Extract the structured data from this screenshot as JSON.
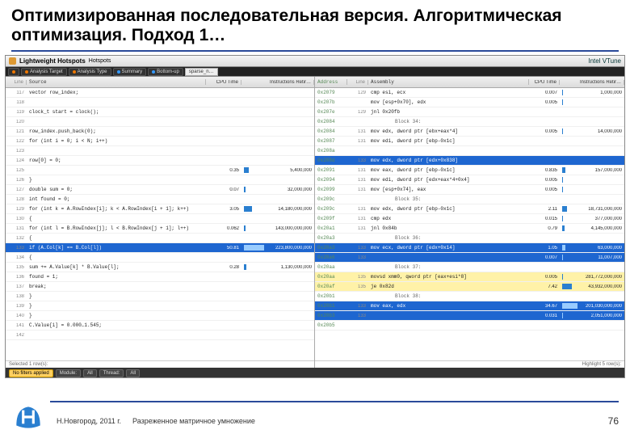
{
  "slide": {
    "title": "Оптимизированная последовательная версия. Алгоритмическая оптимизация. Подход 1…",
    "footer_left": "Н.Новгород, 2011 г.",
    "footer_center": "Разреженное матричное умножение",
    "page": "76"
  },
  "profiler": {
    "window_title": "Lightweight Hotspots",
    "window_sub": "Hotspots",
    "brand": "Intel VTune",
    "tabs": [
      "Analysis Target",
      "Analysis Type",
      "Summary",
      "Bottom-up"
    ],
    "file_tab": "sparse_n…",
    "left": {
      "cols": [
        "Line",
        "Source",
        "CPU Time",
        "",
        "Instructions Retir…"
      ],
      "rows": [
        {
          "line": "117",
          "src": "vector<int> row_index;",
          "cpu": "",
          "ins": ""
        },
        {
          "line": "118",
          "src": "",
          "cpu": "",
          "ins": ""
        },
        {
          "line": "119",
          "src": "clock_t start = clock();",
          "cpu": "",
          "ins": ""
        },
        {
          "line": "120",
          "src": "",
          "cpu": "",
          "ins": ""
        },
        {
          "line": "121",
          "src": "row_index.push_back(0);",
          "cpu": "",
          "ins": ""
        },
        {
          "line": "122",
          "src": "for (int i = 0; i < N; i++)",
          "cpu": "",
          "ins": ""
        },
        {
          "line": "123",
          "src": "",
          "cpu": "",
          "ins": ""
        },
        {
          "line": "124",
          "src": "  row[0] = 0;",
          "cpu": "",
          "ins": ""
        },
        {
          "line": "125",
          "src": "",
          "cpu": "0.35",
          "bar": 6,
          "ins": "5,400,000"
        },
        {
          "line": "126",
          "src": "  }",
          "cpu": "",
          "ins": ""
        },
        {
          "line": "127",
          "src": "  double sum = 0;",
          "cpu": "0.07",
          "bar": 2,
          "ins": "32,000,000"
        },
        {
          "line": "128",
          "src": "  int found = 0;",
          "cpu": "",
          "ins": ""
        },
        {
          "line": "129",
          "src": "  for (int k = A.RowIndex[i]; k < A.RowIndex[i + 1]; k++)",
          "cpu": "3.05",
          "bar": 10,
          "ins": "14,180,000,000"
        },
        {
          "line": "130",
          "src": "  {",
          "cpu": "",
          "ins": ""
        },
        {
          "line": "131",
          "src": "    for (int l = B.RowIndex[j]; l < B.RowIndex[j + 1]; l++)",
          "cpu": "0.062",
          "bar": 2,
          "ins": "143,000,000,000"
        },
        {
          "line": "132",
          "src": "    {",
          "cpu": "",
          "ins": ""
        },
        {
          "sel": true,
          "line": "133",
          "src": "     if (A.Col[k] == B.Col[l])",
          "cpu": "50.81",
          "bar": 28,
          "ins": "223,800,000,000"
        },
        {
          "line": "134",
          "src": "     {",
          "cpu": "",
          "ins": ""
        },
        {
          "line": "135",
          "src": "       sum += A.Value[k] * B.Value[l];",
          "cpu": "0.28",
          "bar": 3,
          "ins": "1,130,000,000"
        },
        {
          "line": "136",
          "src": "       found = 1;",
          "cpu": "",
          "ins": ""
        },
        {
          "line": "137",
          "src": "       break;",
          "cpu": "",
          "ins": ""
        },
        {
          "line": "138",
          "src": "     }",
          "cpu": "",
          "ins": ""
        },
        {
          "line": "139",
          "src": "    }",
          "cpu": "",
          "ins": ""
        },
        {
          "line": "140",
          "src": "  }",
          "cpu": "",
          "ins": ""
        },
        {
          "line": "141",
          "src": "  C.Value[i] = 0.000…1.545;",
          "cpu": "",
          "ins": ""
        },
        {
          "line": "142",
          "src": "",
          "cpu": "",
          "ins": ""
        }
      ],
      "sel_caption": "Selected 1 row(s):"
    },
    "right": {
      "cols": [
        "Address",
        "Line",
        "Assembly",
        "CPU Time",
        "",
        "Instructions Retir…"
      ],
      "rows": [
        {
          "addr": "0x2079",
          "line": "129",
          "asm": "cmp esi, ecx",
          "cpu": "0.007",
          "bar": 1,
          "ins": "1,000,000"
        },
        {
          "addr": "0x207b",
          "line": "",
          "asm": "mov [esp+0x70], edx",
          "cpu": "0.005",
          "bar": 1,
          "ins": ""
        },
        {
          "addr": "0x207e",
          "line": "129",
          "asm": "jnl 0x20fb <Block 130>",
          "cpu": "",
          "ins": ""
        },
        {
          "addr": "0x2084",
          "line": "",
          "asm": "Block 34:",
          "block": true
        },
        {
          "addr": "0x2084",
          "line": "131",
          "asm": "mov edx, dword ptr [ebx+eax*4]",
          "cpu": "0.005",
          "bar": 1,
          "ins": "14,000,000"
        },
        {
          "addr": "0x2087",
          "line": "131",
          "asm": "mov edi, dword ptr [ebp-0x1c]",
          "cpu": "",
          "ins": ""
        },
        {
          "addr": "0x208a",
          "line": "",
          "asm": "",
          "cpu": "",
          "ins": ""
        },
        {
          "sel": true,
          "addr": "0x208d",
          "line": "133",
          "asm": "mov edx, dword ptr [edx+0x838]",
          "cpu": "",
          "ins": ""
        },
        {
          "addr": "0x2091",
          "line": "131",
          "asm": "mov eax, dword ptr [ebp-0x1c]",
          "cpu": "0.835",
          "bar": 4,
          "ins": "157,000,000"
        },
        {
          "addr": "0x2094",
          "line": "131",
          "asm": "mov edi, dword ptr [edx+eax*4+0x4]",
          "cpu": "0.005",
          "bar": 1,
          "ins": ""
        },
        {
          "addr": "0x2099",
          "line": "131",
          "asm": "mov [esp+0x74], eax",
          "cpu": "0.005",
          "bar": 1,
          "ins": ""
        },
        {
          "addr": "0x209c",
          "line": "",
          "asm": "Block 35:",
          "block": true
        },
        {
          "addr": "0x209c",
          "line": "131",
          "asm": "mov edx, dword ptr [ebp-0x1c]",
          "cpu": "2.11",
          "bar": 6,
          "ins": "18,731,000,000"
        },
        {
          "addr": "0x209f",
          "line": "131",
          "asm": "cmp edx",
          "cpu": "0.015",
          "bar": 1,
          "ins": "377,000,000"
        },
        {
          "addr": "0x20a1",
          "line": "131",
          "asm": "jnl 0x84b <Block 46>",
          "cpu": "0.79",
          "bar": 3,
          "ins": "4,145,000,000"
        },
        {
          "addr": "0x20a3",
          "line": "",
          "asm": "Block 36:",
          "block": true
        },
        {
          "sel": true,
          "addr": "0x20a3",
          "line": "133",
          "asm": "mov ecx, dword ptr [edx+0x14]",
          "cpu": "1.05",
          "bar": 4,
          "ins": "63,000,000"
        },
        {
          "sel": true,
          "addr": "0x20a6",
          "line": "133",
          "asm": "",
          "cpu": "0.007",
          "bar": 1,
          "ins": "11,007,000"
        },
        {
          "addr": "0x20aa",
          "line": "",
          "asm": "Block 37:",
          "block": true
        },
        {
          "yel": true,
          "addr": "0x20aa",
          "line": "135",
          "asm": "movsd xmm0, qword ptr [eax+esi*8]",
          "cpu": "0.005",
          "bar": 1,
          "ins": "281,772,000,000"
        },
        {
          "yel": true,
          "addr": "0x20af",
          "line": "135",
          "asm": "je 0x82d <Block 42>",
          "cpu": "7.42",
          "bar": 12,
          "ins": "43,932,000,000"
        },
        {
          "addr": "0x20b1",
          "line": "",
          "asm": "Block 38:",
          "block": true
        },
        {
          "sel": true,
          "addr": "0x20b1",
          "line": "133",
          "asm": "mov eax, edx",
          "cpu": "34.67",
          "bar": 22,
          "ins": "201,030,000,000"
        },
        {
          "sel": true,
          "addr": "0x20b3",
          "line": "133",
          "asm": "",
          "cpu": "0.031",
          "bar": 1,
          "ins": "2,051,000,000"
        },
        {
          "addr": "0x20b5",
          "line": "",
          "asm": "",
          "cpu": "",
          "ins": ""
        }
      ],
      "highlight": "Highlight 5 row(s):"
    },
    "footbar": {
      "pill1": "No filters applied",
      "label2": "Module:",
      "val2": "All",
      "label3": "Thread:",
      "val3": "All"
    }
  }
}
